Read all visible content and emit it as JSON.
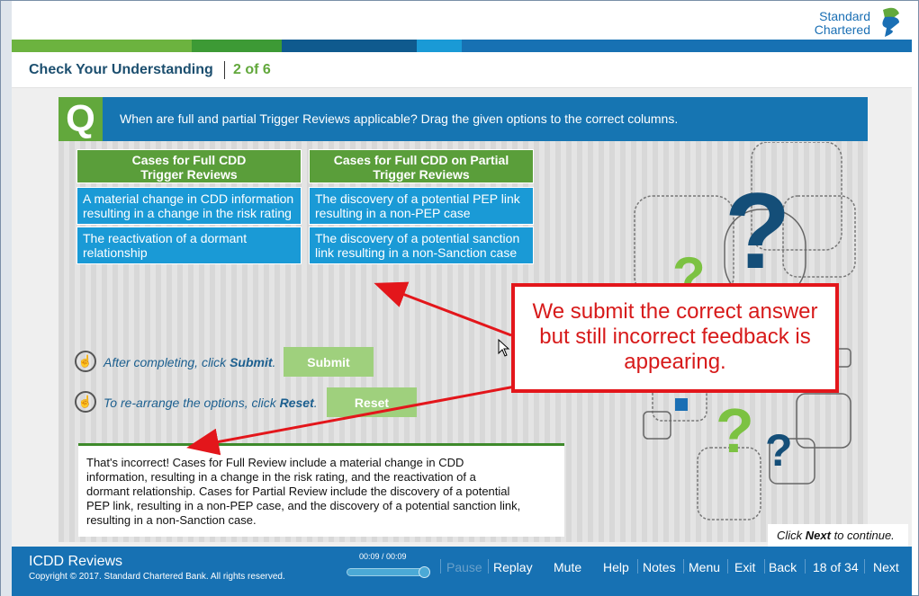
{
  "brand": {
    "line1": "Standard",
    "line2": "Chartered",
    "color_blue": "#1a6fb4",
    "color_green": "#62a83c"
  },
  "titlebar": {
    "title": "Check Your Understanding",
    "progress": "2 of 6"
  },
  "question": {
    "badge": "Q",
    "text": "When are full and partial Trigger Reviews applicable? Drag the given options to the correct columns."
  },
  "columns": [
    {
      "header": [
        "Cases for Full CDD",
        "Trigger Reviews"
      ],
      "items": [
        [
          "A material change in CDD information",
          "resulting in a change in the risk rating"
        ],
        [
          "The reactivation of a dormant",
          "relationship"
        ]
      ]
    },
    {
      "header": [
        "Cases for Full CDD on Partial",
        "Trigger Reviews"
      ],
      "items": [
        [
          "The discovery of a potential PEP link",
          "resulting in a non-PEP case"
        ],
        [
          "The discovery of a potential sanction",
          "link resulting in a non-Sanction case"
        ]
      ]
    }
  ],
  "instructions": {
    "submit_pre": "After completing, click ",
    "submit_word": "Submit",
    "submit_post": ".",
    "reset_pre": "To re-arrange the options, click ",
    "reset_word": "Reset",
    "reset_post": "."
  },
  "buttons": {
    "submit": "Submit",
    "reset": "Reset"
  },
  "feedback": [
    "That's incorrect! Cases for Full Review include a material change in CDD",
    "information, resulting in a change in the risk rating, and the reactivation of a",
    "dormant relationship. Cases for Partial Review include the discovery of a potential",
    "PEP link, resulting in a non-PEP case, and the discovery of a potential sanction link,",
    "resulting in a non-Sanction case."
  ],
  "annotation": [
    "We submit the correct answer",
    "but still incorrect feedback is",
    "appearing."
  ],
  "continue_hint": {
    "pre": "Click ",
    "word": "Next",
    "post": " to continue."
  },
  "footer": {
    "course": "ICDD Reviews",
    "copyright": "Copyright © 2017. Standard Chartered Bank. All rights reserved.",
    "time": "00:09 / 00:09",
    "playback_progress": 1.0,
    "nav": {
      "pause": "Pause",
      "replay": "Replay",
      "mute": "Mute",
      "help": "Help",
      "notes": "Notes",
      "menu": "Menu",
      "exit": "Exit",
      "back": "Back",
      "page": "18 of 34",
      "next": "Next"
    }
  }
}
